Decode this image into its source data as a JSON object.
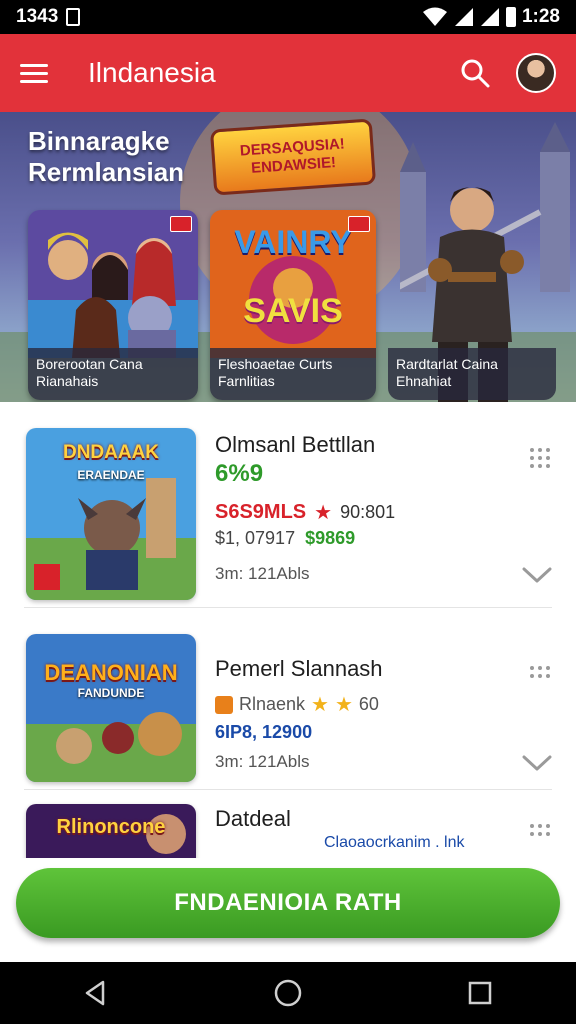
{
  "status_bar": {
    "time_left": "1343",
    "time_right": "1:28"
  },
  "app_bar": {
    "title": "Ilndanesia",
    "icons": [
      "menu-icon",
      "search-icon",
      "avatar"
    ]
  },
  "hero": {
    "title_line1": "Binnaragke",
    "title_line2": "Rermlansian",
    "logo_line1": "DERSAQUSIA!",
    "logo_line2": "ENDAWSIE!",
    "cards": [
      {
        "caption_line1": "Borerootan Cana",
        "caption_line2": "Rianahais"
      },
      {
        "caption_line1": "Fleshoaetae Curts",
        "caption_line2": "Farnlitias",
        "logo_line1": "VAINRY",
        "logo_line2": "SAVIS"
      },
      {
        "caption_line1": "Rardtarlat Caina",
        "caption_line2": "Ehnahiat"
      }
    ]
  },
  "list": [
    {
      "thumb_title": "DNDAAAK",
      "thumb_subtitle": "ERAENDAE",
      "name": "Olmsanl Bettllan",
      "rating": "6%9",
      "price_red": "S6S9MLS",
      "price_extra": "90:801",
      "price_gray": "$1, 07917",
      "price_green": "$9869",
      "meta": "3m: 121Abls"
    },
    {
      "thumb_title": "DEANONIAN",
      "thumb_subtitle": "FANDUNDE",
      "name": "Pemerl Slannash",
      "badge": "Rlnaenk",
      "stars": "60",
      "price_blue": "6IP8, 12900",
      "meta": "3m: 121Abls"
    },
    {
      "thumb_title": "Rlinoncone",
      "name": "Datdeal",
      "sub_blue": "Claoaocrkanim . lnk"
    }
  ],
  "cta": {
    "label": "FNDAENIOIA RATH"
  },
  "colors": {
    "app_bar": "#e2323a",
    "cta": "#4caf30",
    "price_red": "#d8222a",
    "price_green": "#2e9a2a",
    "price_blue": "#1a4aa8"
  }
}
